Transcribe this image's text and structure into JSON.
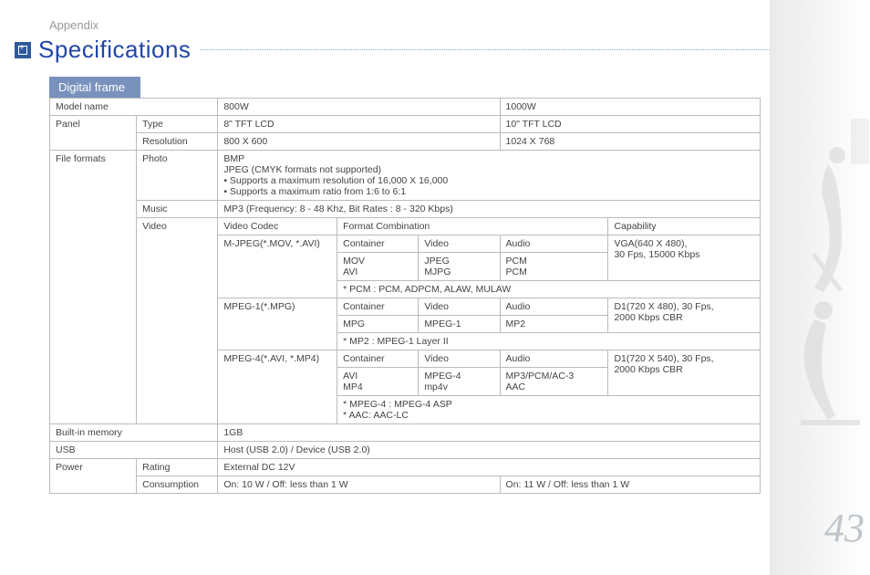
{
  "header": {
    "section": "Appendix",
    "title": "Specifications",
    "subheader": "Digital frame"
  },
  "page_number": "43",
  "labels": {
    "model_name": "Model name",
    "panel": "Panel",
    "type": "Type",
    "resolution": "Resolution",
    "file_formats": "File formats",
    "photo": "Photo",
    "music": "Music",
    "video": "Video",
    "video_codec": "Video Codec",
    "format_combination": "Format Combination",
    "capability": "Capability",
    "container": "Container",
    "video_col": "Video",
    "audio": "Audio",
    "built_in_memory": "Built-in memory",
    "usb": "USB",
    "power": "Power",
    "rating": "Rating",
    "consumption": "Consumption"
  },
  "models": {
    "a": "800W",
    "b": "1000W"
  },
  "panel": {
    "type_a": "8\" TFT LCD",
    "type_b": "10\" TFT LCD",
    "res_a": "800 X 600",
    "res_b": "1024 X 768"
  },
  "photo": {
    "line1": "BMP",
    "line2": "JPEG (CMYK formats not supported)",
    "line3": "•  Supports a maximum resolution of 16,000 X 16,000",
    "line4": "•  Supports a maximum ratio from 1:6 to 6:1"
  },
  "music": "MP3 (Frequency: 8 - 48 Khz, Bit Rates : 8 - 320 Kbps)",
  "video": {
    "c1": {
      "codec": "M-JPEG(*.MOV, *.AVI)",
      "container_a": "MOV",
      "container_b": "AVI",
      "video_a": "JPEG",
      "video_b": "MJPG",
      "audio_a": "PCM",
      "audio_b": "PCM",
      "cap_a": "VGA(640 X 480),",
      "cap_b": "30 Fps, 15000 Kbps",
      "note": "* PCM : PCM, ADPCM, ALAW, MULAW"
    },
    "c2": {
      "codec": "MPEG-1(*.MPG)",
      "container": "MPG",
      "video": "MPEG-1",
      "audio": "MP2",
      "cap_a": "D1(720 X 480), 30 Fps,",
      "cap_b": "2000 Kbps CBR",
      "note": "* MP2 : MPEG-1 Layer II"
    },
    "c3": {
      "codec": "MPEG-4(*.AVI, *.MP4)",
      "container_a": "AVI",
      "container_b": "MP4",
      "video_a": "MPEG-4",
      "video_b": "mp4v",
      "audio_a": "MP3/PCM/AC-3",
      "audio_b": "AAC",
      "cap_a": "D1(720 X 540), 30 Fps,",
      "cap_b": "2000 Kbps CBR",
      "note_a": "* MPEG-4 : MPEG-4 ASP",
      "note_b": "* AAC: AAC-LC"
    }
  },
  "memory": "1GB",
  "usb": "Host (USB 2.0) / Device (USB 2.0)",
  "power": {
    "rating": "External DC 12V",
    "cons_a": "On: 10 W / Off: less than 1 W",
    "cons_b": "On: 11 W / Off: less than 1 W"
  }
}
